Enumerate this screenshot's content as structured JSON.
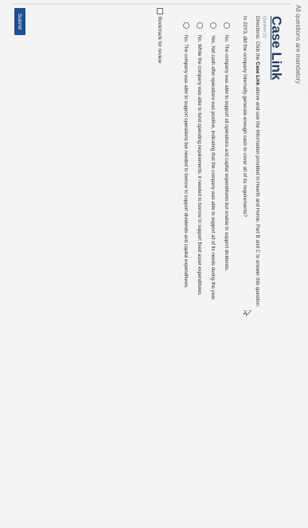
{
  "header": {
    "mandatory_text": "All questions are mandatory"
  },
  "question": {
    "title": "Case Link",
    "number_label": "Question (1)",
    "directions_prefix": "Directions: Click the ",
    "directions_bold": "Case Link",
    "directions_suffix": " above and use the information provided in Hearth and Home, Part B and C to answer this question:",
    "prompt": "In 20Y3, did the company internally generate enough cash to cover all of its requirements?",
    "options": [
      {
        "label": "No. The company was able to support all operations and capital expenditures but unable to support dividends."
      },
      {
        "label": "Yes. Net cash after operations was positive, indicating that the company was able to support all of its needs during the year."
      },
      {
        "label": "No. While the company was able to fund operating requirements, it needed to borrow to support fixed asset expenditures."
      },
      {
        "label": "No. The company was able to support operations but needed to borrow to support dividends and capital expenditures."
      }
    ]
  },
  "bookmark": {
    "label": "Bookmark for review",
    "checked": false
  },
  "submit": {
    "label": "Submit",
    "color": "#1d4f91"
  },
  "cursor": {
    "icon": "arrow-pointer-icon"
  }
}
